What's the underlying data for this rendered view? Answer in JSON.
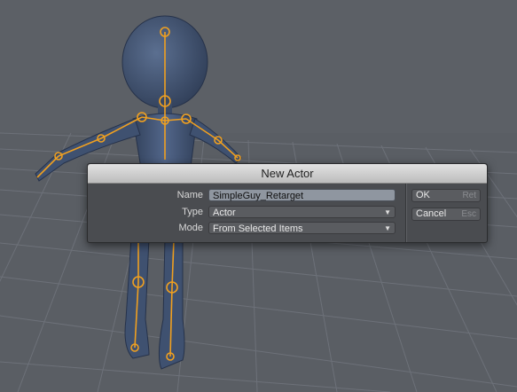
{
  "dialog": {
    "title": "New Actor",
    "name": {
      "label": "Name",
      "value": "SimpleGuy_Retarget"
    },
    "type": {
      "label": "Type",
      "value": "Actor"
    },
    "mode": {
      "label": "Mode",
      "value": "From Selected Items"
    },
    "ok_button": {
      "label": "OK",
      "shortcut": "Ret"
    },
    "cancel_button": {
      "label": "Cancel",
      "shortcut": "Esc"
    }
  },
  "colors": {
    "viewport_bg": "#5c6066",
    "grid": "#6c7078",
    "mesh": "#3f5170",
    "skeleton": "#f0a020"
  }
}
